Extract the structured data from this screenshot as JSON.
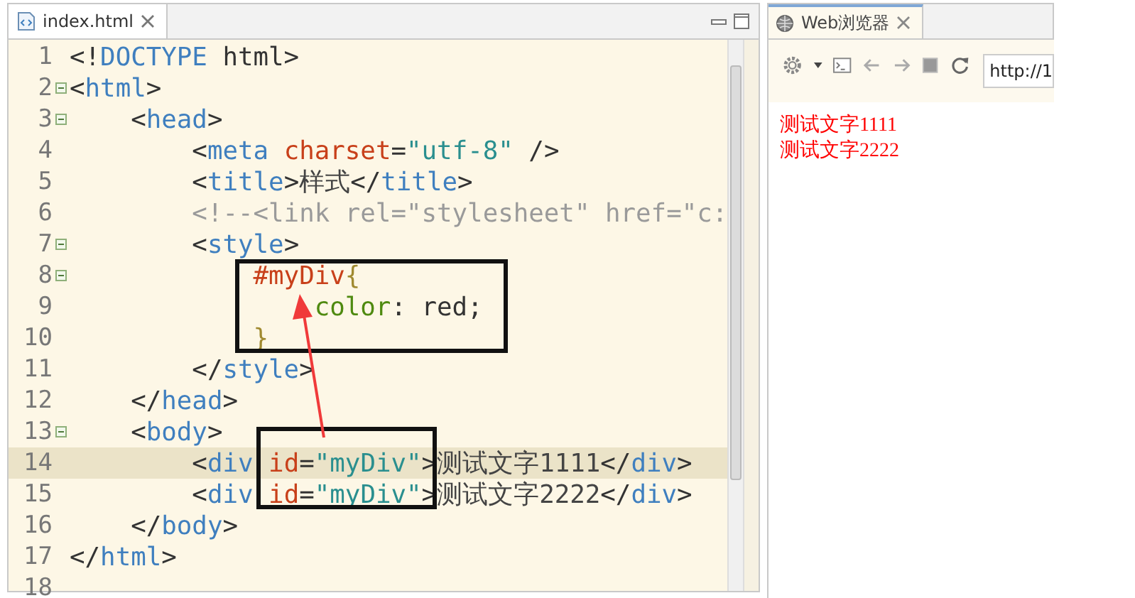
{
  "editor": {
    "tab": {
      "label": "index.html",
      "selected": true
    },
    "lines": [
      {
        "number": "1",
        "foldable": false,
        "current": false,
        "tokens": [
          {
            "kind": "punct",
            "text": "<!"
          },
          {
            "kind": "tag",
            "text": "DOCTYPE"
          },
          {
            "kind": "punct",
            "text": " html>"
          }
        ]
      },
      {
        "number": "2",
        "foldable": true,
        "current": false,
        "tokens": [
          {
            "kind": "punct",
            "text": "<"
          },
          {
            "kind": "tag",
            "text": "html"
          },
          {
            "kind": "punct",
            "text": ">"
          }
        ]
      },
      {
        "number": "3",
        "foldable": true,
        "current": false,
        "tokens": [
          {
            "kind": "punct",
            "text": "    <"
          },
          {
            "kind": "tag",
            "text": "head"
          },
          {
            "kind": "punct",
            "text": ">"
          }
        ]
      },
      {
        "number": "4",
        "foldable": false,
        "current": false,
        "tokens": [
          {
            "kind": "punct",
            "text": "        <"
          },
          {
            "kind": "tag",
            "text": "meta "
          },
          {
            "kind": "attr",
            "text": "charset"
          },
          {
            "kind": "punct",
            "text": "="
          },
          {
            "kind": "value",
            "text": "\"utf-8\""
          },
          {
            "kind": "punct",
            "text": " />"
          }
        ]
      },
      {
        "number": "5",
        "foldable": false,
        "current": false,
        "tokens": [
          {
            "kind": "punct",
            "text": "        <"
          },
          {
            "kind": "tag",
            "text": "title"
          },
          {
            "kind": "punct",
            "text": ">"
          },
          {
            "kind": "text",
            "text": "样式"
          },
          {
            "kind": "punct",
            "text": "</"
          },
          {
            "kind": "tag",
            "text": "title"
          },
          {
            "kind": "punct",
            "text": ">"
          }
        ]
      },
      {
        "number": "6",
        "foldable": false,
        "current": false,
        "tokens": [
          {
            "kind": "comment",
            "text": "        <!--<link rel=\"stylesheet\" href=\"c:"
          }
        ]
      },
      {
        "number": "7",
        "foldable": true,
        "current": false,
        "tokens": [
          {
            "kind": "punct",
            "text": "        <"
          },
          {
            "kind": "tag",
            "text": "style"
          },
          {
            "kind": "punct",
            "text": ">"
          }
        ]
      },
      {
        "number": "8",
        "foldable": true,
        "current": false,
        "tokens": [
          {
            "kind": "selector",
            "text": "            #myDiv"
          },
          {
            "kind": "brace",
            "text": "{"
          }
        ]
      },
      {
        "number": "9",
        "foldable": false,
        "current": false,
        "tokens": [
          {
            "kind": "prop",
            "text": "                color"
          },
          {
            "kind": "punct",
            "text": ": red;"
          }
        ]
      },
      {
        "number": "10",
        "foldable": false,
        "current": false,
        "tokens": [
          {
            "kind": "brace",
            "text": "            }"
          }
        ]
      },
      {
        "number": "11",
        "foldable": false,
        "current": false,
        "tokens": [
          {
            "kind": "punct",
            "text": "        </"
          },
          {
            "kind": "tag",
            "text": "style"
          },
          {
            "kind": "punct",
            "text": ">"
          }
        ]
      },
      {
        "number": "12",
        "foldable": false,
        "current": false,
        "tokens": [
          {
            "kind": "punct",
            "text": "    </"
          },
          {
            "kind": "tag",
            "text": "head"
          },
          {
            "kind": "punct",
            "text": ">"
          }
        ]
      },
      {
        "number": "13",
        "foldable": true,
        "current": false,
        "tokens": [
          {
            "kind": "punct",
            "text": "    <"
          },
          {
            "kind": "tag",
            "text": "body"
          },
          {
            "kind": "punct",
            "text": ">"
          }
        ]
      },
      {
        "number": "14",
        "foldable": false,
        "current": true,
        "tokens": [
          {
            "kind": "punct",
            "text": "        <"
          },
          {
            "kind": "tag",
            "text": "div "
          },
          {
            "kind": "attr",
            "text": "id"
          },
          {
            "kind": "punct",
            "text": "="
          },
          {
            "kind": "value",
            "text": "\"myDiv\""
          },
          {
            "kind": "punct",
            "text": ">"
          },
          {
            "kind": "text",
            "text": "测试文字1111"
          },
          {
            "kind": "punct",
            "text": "</"
          },
          {
            "kind": "tag",
            "text": "div"
          },
          {
            "kind": "punct",
            "text": ">"
          }
        ]
      },
      {
        "number": "15",
        "foldable": false,
        "current": false,
        "tokens": [
          {
            "kind": "punct",
            "text": "        <"
          },
          {
            "kind": "tag",
            "text": "div "
          },
          {
            "kind": "attr",
            "text": "id"
          },
          {
            "kind": "punct",
            "text": "="
          },
          {
            "kind": "value",
            "text": "\"myDiv\""
          },
          {
            "kind": "punct",
            "text": ">"
          },
          {
            "kind": "text",
            "text": "测试文字2222"
          },
          {
            "kind": "punct",
            "text": "</"
          },
          {
            "kind": "tag",
            "text": "div"
          },
          {
            "kind": "punct",
            "text": ">"
          }
        ]
      },
      {
        "number": "16",
        "foldable": false,
        "current": false,
        "tokens": [
          {
            "kind": "punct",
            "text": "    </"
          },
          {
            "kind": "tag",
            "text": "body"
          },
          {
            "kind": "punct",
            "text": ">"
          }
        ]
      },
      {
        "number": "17",
        "foldable": false,
        "current": false,
        "tokens": [
          {
            "kind": "punct",
            "text": "</"
          },
          {
            "kind": "tag",
            "text": "html"
          },
          {
            "kind": "punct",
            "text": ">"
          }
        ]
      },
      {
        "number": "18",
        "foldable": false,
        "current": false
      }
    ]
  },
  "browser": {
    "tab": {
      "label": "Web浏览器",
      "selected": true
    },
    "url": "http://1",
    "content": [
      "测试文字1111",
      "测试文字2222"
    ]
  }
}
